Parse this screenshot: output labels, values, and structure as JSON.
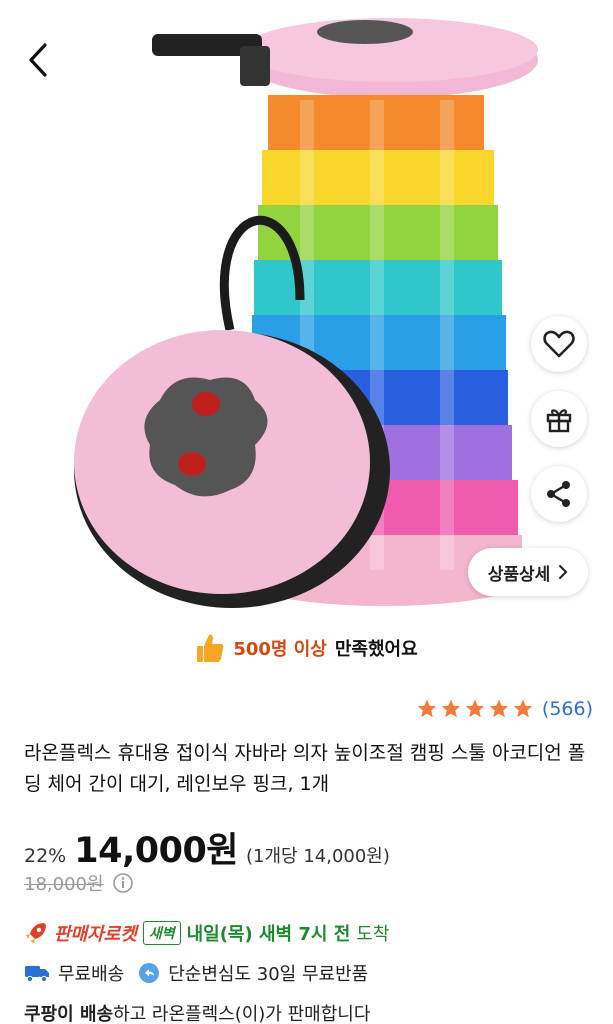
{
  "header": {
    "back_icon": "chevron-left-icon"
  },
  "actions": [
    {
      "name": "wishlist-button",
      "icon": "heart-outline-icon"
    },
    {
      "name": "gift-button",
      "icon": "gift-icon"
    },
    {
      "name": "share-button",
      "icon": "share-icon"
    }
  ],
  "detail_button": {
    "label": "상품상세"
  },
  "satisfaction": {
    "highlight": "500명 이상",
    "suffix": "만족했어요",
    "icon": "thumbs-up-icon"
  },
  "rating": {
    "stars": 5,
    "max_stars": 5,
    "count_text": "(566)",
    "star_color": "#f47a3b"
  },
  "product": {
    "title": "라온플렉스 휴대용 접이식 자바라 의자 높이조절 캠핑 스툴 아코디언 폴딩 체어 간이 대기, 레인보우 핑크, 1개"
  },
  "pricing": {
    "discount": "22%",
    "price": "14,000원",
    "unit_price": "(1개당 14,000원)",
    "original_price": "18,000원"
  },
  "delivery": {
    "rocket_label": "판매자로켓",
    "dawn_badge": "새벽",
    "arrival": "내일(목) 새벽 7시 전",
    "arrival_suffix": "도착",
    "free_shipping": "무료배송",
    "returns": "단순변심도 30일 무료반품"
  },
  "seller": {
    "bold": "쿠팡이 배송",
    "rest": "하고 라온플렉스(이)가 판매합니다"
  },
  "colors": {
    "accent_orange": "#d4490f",
    "link_blue": "#2b6fd6",
    "rocket_red": "#e0402a",
    "dawn_green": "#1d8a2f"
  }
}
